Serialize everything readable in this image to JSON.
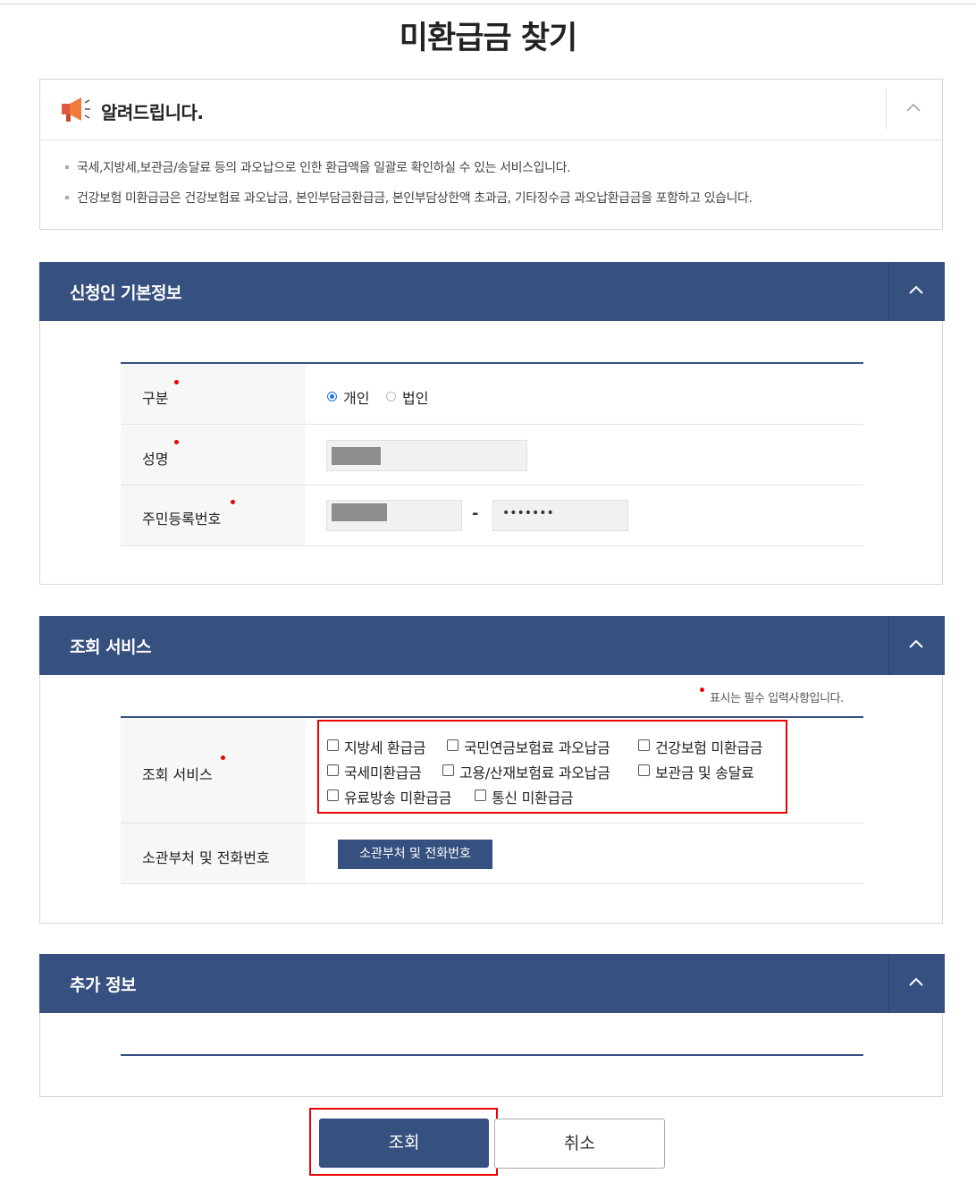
{
  "page": {
    "title": "미환급금 찾기"
  },
  "notice": {
    "title": "알려드립니다.",
    "icon": "megaphone-icon",
    "lines": [
      "국세,지방세,보관금/송달료 등의 과오납으로 인한 환급액을 일괄로 확인하실 수 있는 서비스입니다.",
      "건강보험 미환급금은 건강보험료 과오납금, 본인부담금환급금, 본인부담상한액 초과금, 기타징수금 과오납환급금을 포함하고 있습니다."
    ]
  },
  "applicant": {
    "title": "신청인 기본정보",
    "type_label": "구분",
    "type_options": [
      {
        "label": "개인",
        "selected": true
      },
      {
        "label": "법인",
        "selected": false
      }
    ],
    "name_label": "성명",
    "rrn_label": "주민등록번호",
    "rrn_separator": "-",
    "rrn_back_value": "•••••••"
  },
  "service": {
    "title": "조회 서비스",
    "required_note": "표시는 필수 입력사항입니다.",
    "service_label": "조회 서비스",
    "options": [
      {
        "label": "지방세 환급금",
        "checked": false
      },
      {
        "label": "국민연금보험료 과오납금",
        "checked": false
      },
      {
        "label": "건강보험 미환급금",
        "checked": false
      },
      {
        "label": "국세미환급금",
        "checked": false
      },
      {
        "label": "고용/산재보험료 과오납금",
        "checked": false
      },
      {
        "label": "보관금 및 송달료",
        "checked": false
      },
      {
        "label": "유료방송 미환급금",
        "checked": false
      },
      {
        "label": "통신 미환급금",
        "checked": false
      }
    ],
    "dept_label": "소관부처 및 전화번호",
    "dept_button": "소관부처 및 전화번호"
  },
  "extra": {
    "title": "추가 정보"
  },
  "actions": {
    "search": "조회",
    "cancel": "취소"
  },
  "colors": {
    "primary": "#36507f",
    "highlight": "#e00000",
    "required_dot": "#e00000",
    "radio_selected": "#1a73e8"
  }
}
